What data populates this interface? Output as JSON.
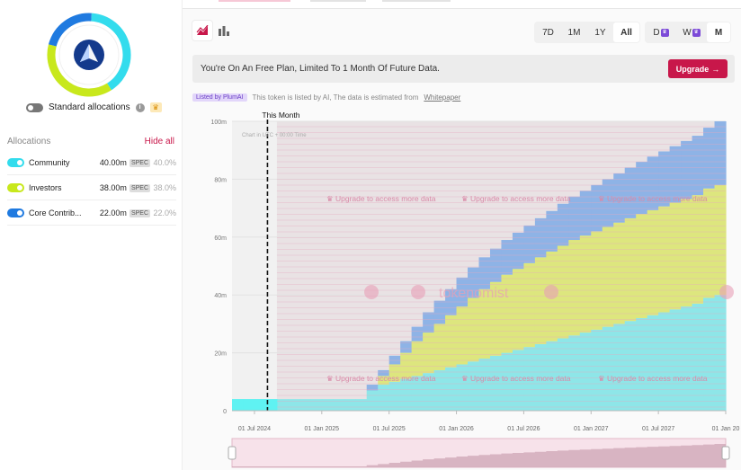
{
  "sidebar": {
    "standard_allocations_label": "Standard allocations",
    "allocations_title": "Allocations",
    "hide_all_label": "Hide all",
    "allocations": [
      {
        "name": "Community",
        "amount": "40.00m",
        "spec": "SPEC",
        "pct": "40.0%",
        "color": "#33dced"
      },
      {
        "name": "Investors",
        "amount": "38.00m",
        "spec": "SPEC",
        "pct": "38.0%",
        "color": "#c8e81c"
      },
      {
        "name": "Core Contrib...",
        "amount": "22.00m",
        "spec": "SPEC",
        "pct": "22.0%",
        "color": "#1f7ae0"
      }
    ]
  },
  "toolbar": {
    "range_buttons": [
      "7D",
      "1M",
      "1Y",
      "All"
    ],
    "active_range": "All",
    "granularity_buttons": [
      "D",
      "W",
      "M"
    ],
    "active_granularity": "M"
  },
  "banner": {
    "text": "You're On An Free Plan, Limited To 1 Month Of Future Data.",
    "upgrade_label": "Upgrade"
  },
  "listed": {
    "badge": "Listed by PlumAI",
    "text": "This token is listed by AI, The data is estimated from",
    "link": "Whitepaper"
  },
  "chart_data": {
    "type": "area",
    "stacked": true,
    "marker_label": "This Month",
    "overlay_note": "Chart in UTC + 00:00 Time",
    "upgrade_overlay_text": "Upgrade to access more data",
    "watermark": "tokenomist",
    "y_ticks": [
      "0",
      "20m",
      "40m",
      "60m",
      "80m",
      "100m"
    ],
    "ylim": [
      0,
      100
    ],
    "x_ticks": [
      "01 Jul 2024",
      "01 Jan 2025",
      "01 Jul 2025",
      "01 Jan 2026",
      "01 Jul 2026",
      "01 Jan 2027",
      "01 Jul 2027",
      "01 Jan 20"
    ],
    "x_dates": [
      "2024-05",
      "2024-06",
      "2024-07",
      "2024-08",
      "2024-09",
      "2024-10",
      "2024-11",
      "2024-12",
      "2025-01",
      "2025-02",
      "2025-03",
      "2025-04",
      "2025-05",
      "2025-06",
      "2025-07",
      "2025-08",
      "2025-09",
      "2025-10",
      "2025-11",
      "2025-12",
      "2026-01",
      "2026-02",
      "2026-03",
      "2026-04",
      "2026-05",
      "2026-06",
      "2026-07",
      "2026-08",
      "2026-09",
      "2026-10",
      "2026-11",
      "2026-12",
      "2027-01",
      "2027-02",
      "2027-03",
      "2027-04",
      "2027-05",
      "2027-06",
      "2027-07",
      "2027-08",
      "2027-09",
      "2027-10",
      "2027-11",
      "2027-12"
    ],
    "series": [
      {
        "name": "Community",
        "color": "#8ee6e8",
        "values": [
          4,
          4,
          4,
          4,
          4,
          4,
          4,
          4,
          4,
          4,
          4,
          4,
          7,
          9,
          10,
          11,
          12,
          13,
          14,
          15,
          16,
          17,
          18,
          19,
          20,
          21,
          22,
          23,
          24,
          25,
          26,
          27,
          28,
          29,
          30,
          31,
          32,
          33,
          34,
          35,
          36,
          37,
          39,
          40
        ]
      },
      {
        "name": "Investors",
        "color": "#dde67e",
        "values": [
          0,
          0,
          0,
          0,
          0,
          0,
          0,
          0,
          0,
          0,
          0,
          0,
          0,
          3,
          6,
          9,
          12,
          14,
          16,
          18,
          20,
          22,
          24,
          25.5,
          27,
          28,
          29,
          30,
          31,
          32,
          33,
          33.5,
          34,
          34.5,
          35,
          35.5,
          36,
          36.3,
          36.6,
          36.9,
          37.2,
          37.5,
          37.8,
          38
        ]
      },
      {
        "name": "Core Contributors",
        "color": "#8eb3e6",
        "values": [
          0,
          0,
          0,
          0,
          0,
          0,
          0,
          0,
          0,
          0,
          0,
          0,
          2,
          2,
          3,
          4,
          5,
          7,
          8,
          9,
          10,
          10.5,
          11,
          11.5,
          12,
          12.5,
          13,
          13.5,
          14,
          14.5,
          15,
          15.5,
          16,
          16.5,
          17,
          17.5,
          18,
          18.5,
          19,
          19.5,
          20,
          20.5,
          21,
          22
        ]
      }
    ],
    "current_month_index": 3,
    "free_data_until_index": 4
  }
}
